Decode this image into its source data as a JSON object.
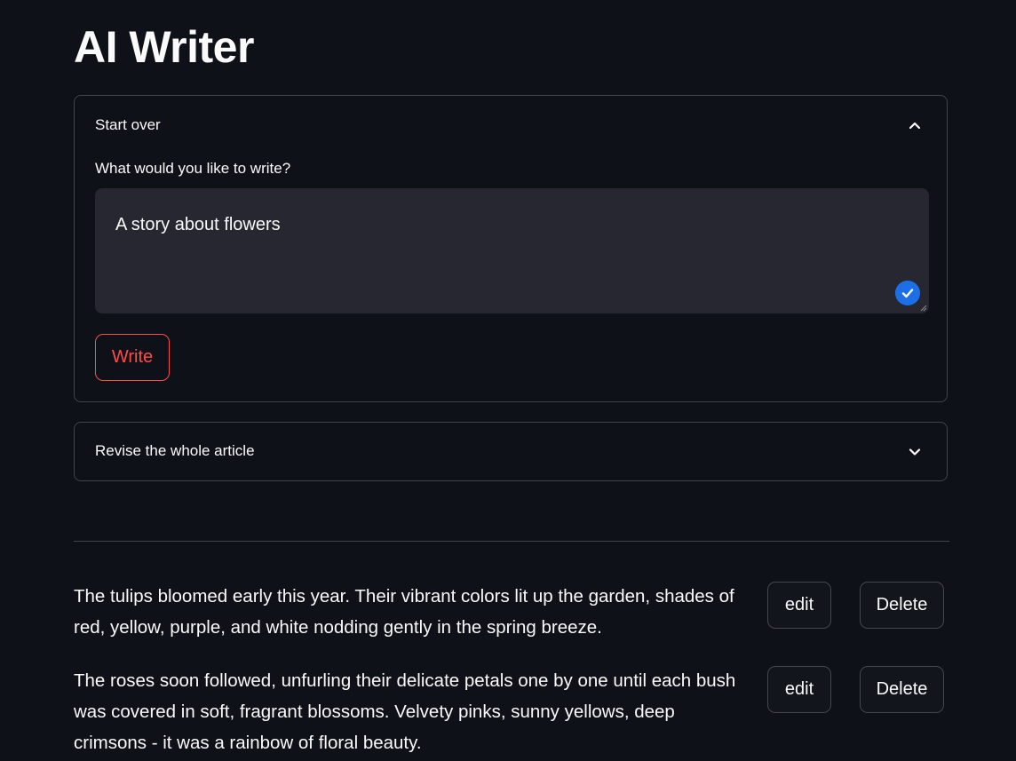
{
  "app": {
    "title": "AI Writer"
  },
  "start_over": {
    "label": "Start over",
    "expanded": true,
    "icon": "chevron-up-icon",
    "prompt_label": "What would you like to write?",
    "prompt_value": "A story about flowers",
    "write_label": "Write"
  },
  "revise": {
    "label": "Revise the whole article",
    "expanded": false,
    "icon": "chevron-down-icon"
  },
  "paragraphs": [
    {
      "text": "The tulips bloomed early this year. Their vibrant colors lit up the garden, shades of red, yellow, purple, and white nodding gently in the spring breeze.",
      "edit_label": "edit",
      "delete_label": "Delete"
    },
    {
      "text": "The roses soon followed, unfurling their delicate petals one by one until each bush was covered in soft, fragrant blossoms. Velvety pinks, sunny yellows, deep crimsons - it was a rainbow of floral beauty.",
      "edit_label": "edit",
      "delete_label": "Delete"
    }
  ],
  "colors": {
    "background": "#0e1117",
    "accent": "#ff4b4b",
    "input_background": "#262730",
    "check_badge": "#1c6fe6"
  }
}
